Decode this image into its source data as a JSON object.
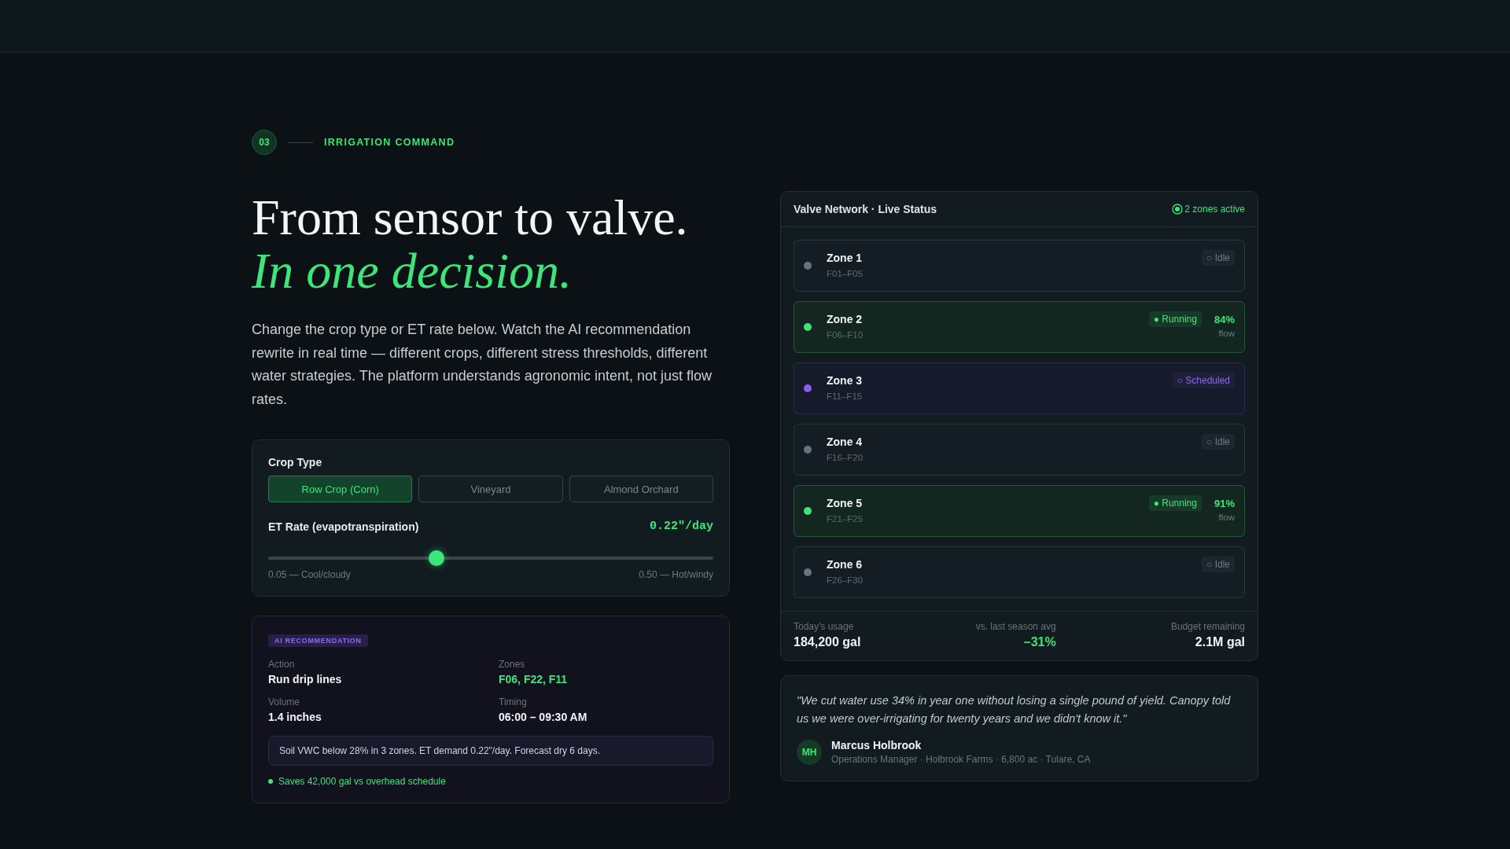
{
  "section": {
    "number": "03",
    "label": "IRRIGATION COMMAND"
  },
  "headline": {
    "plain": "From sensor to valve.",
    "accent": "In one decision."
  },
  "intro": "Change the crop type or ET rate below. Watch the AI recommendation rewrite in real time — different crops, different stress thresholds, different water strategies. The platform understands agronomic intent, not just flow rates.",
  "controls": {
    "crop_label": "Crop Type",
    "crops": [
      {
        "label": "Row Crop (Corn)",
        "selected": true
      },
      {
        "label": "Vineyard",
        "selected": false
      },
      {
        "label": "Almond Orchard",
        "selected": false
      }
    ],
    "et_label": "ET Rate (evapotranspiration)",
    "et_value": "0.22\"/day",
    "level": 0.378,
    "min_label": "0.05 — Cool/cloudy",
    "max_label": "0.50 — Hot/windy"
  },
  "recommendation": {
    "badge": "AI RECOMMENDATION",
    "fields": [
      {
        "label": "Action",
        "value": "Run drip lines",
        "kind": "plain"
      },
      {
        "label": "Zones",
        "value": "F06, F22, F11",
        "kind": "accent"
      },
      {
        "label": "Volume",
        "value": "1.4 inches",
        "kind": "plain"
      },
      {
        "label": "Timing",
        "value": "06:00 – 09:30 AM",
        "kind": "plain"
      }
    ],
    "note": "Soil VWC below 28% in 3 zones. ET demand 0.22\"/day. Forecast dry 6 days.",
    "savings": "Saves 42,000 gal vs overhead schedule"
  },
  "valves": {
    "title": "Valve Network · Live Status",
    "active": "2 zones active",
    "zones": [
      {
        "name": "Zone 1",
        "range": "F01–F05",
        "kind": "idle",
        "status": "○ Idle"
      },
      {
        "name": "Zone 2",
        "range": "F06–F10",
        "kind": "running",
        "status": "● Running",
        "flow": "84%",
        "flow_label": "flow"
      },
      {
        "name": "Zone 3",
        "range": "F11–F15",
        "kind": "scheduled",
        "status": "○ Scheduled"
      },
      {
        "name": "Zone 4",
        "range": "F16–F20",
        "kind": "idle",
        "status": "○ Idle"
      },
      {
        "name": "Zone 5",
        "range": "F21–F25",
        "kind": "running",
        "status": "● Running",
        "flow": "91%",
        "flow_label": "flow"
      },
      {
        "name": "Zone 6",
        "range": "F26–F30",
        "kind": "idle",
        "status": "○ Idle"
      }
    ],
    "stats": [
      {
        "label": "Today's usage",
        "value": "184,200 gal",
        "kind": "plain"
      },
      {
        "label": "vs. last season avg",
        "value": "–31%",
        "kind": "accent"
      },
      {
        "label": "Budget remaining",
        "value": "2.1M gal",
        "kind": "plain"
      }
    ]
  },
  "testimonial": {
    "quote": "\"We cut water use 34% in year one without losing a single pound of yield. Canopy told us we were over-irrigating for twenty years and we didn't know it.\"",
    "initials": "MH",
    "name": "Marcus Holbrook",
    "role": "Operations Manager · Holbrook Farms · 6,800 ac · Tulare, CA"
  }
}
